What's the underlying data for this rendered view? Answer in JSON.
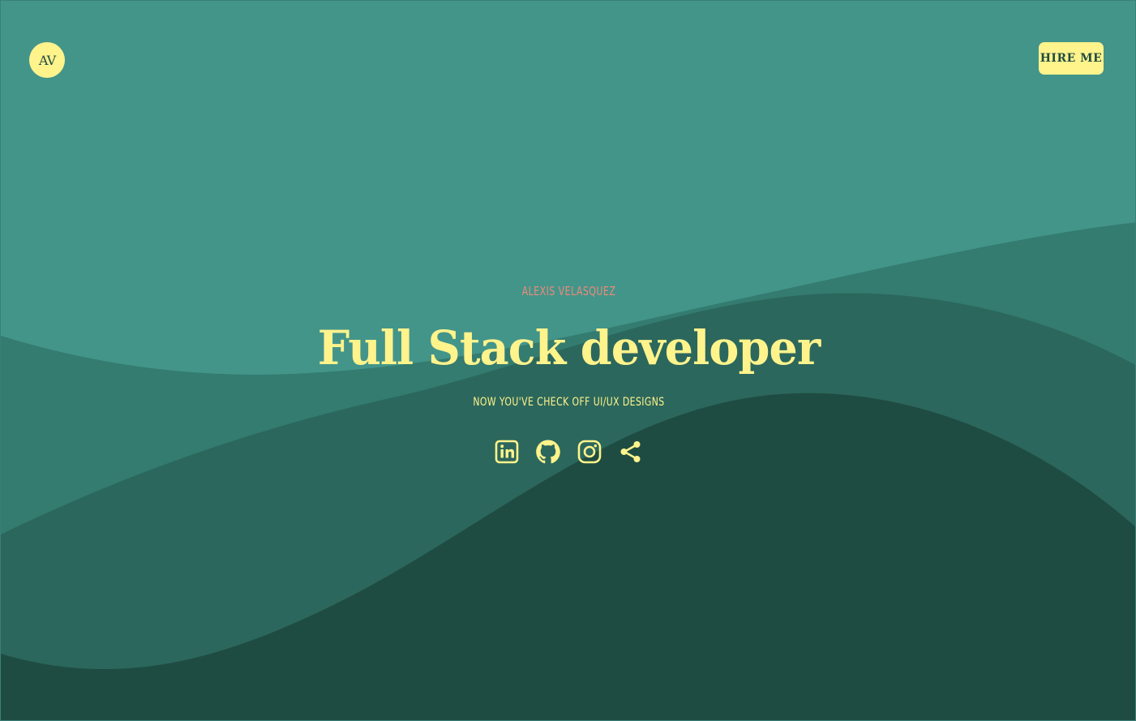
{
  "header": {
    "logo_text": "AV",
    "hire_label": "HIRE ME"
  },
  "hero": {
    "name": "ALEXIS VELASQUEZ",
    "title": "Full Stack developer",
    "subtitle": "NOW YOU'VE CHECK OFF UI/UX DESIGNS"
  },
  "social": {
    "items": [
      {
        "icon": "linkedin-icon"
      },
      {
        "icon": "github-icon"
      },
      {
        "icon": "instagram-icon"
      },
      {
        "icon": "share-icon"
      }
    ]
  },
  "colors": {
    "background": "#43958a",
    "wave_1": "#347b70",
    "wave_2": "#2b675c",
    "wave_3": "#1f4c42",
    "accent_yellow": "#fff38c",
    "accent_salmon": "#ec8a78"
  }
}
